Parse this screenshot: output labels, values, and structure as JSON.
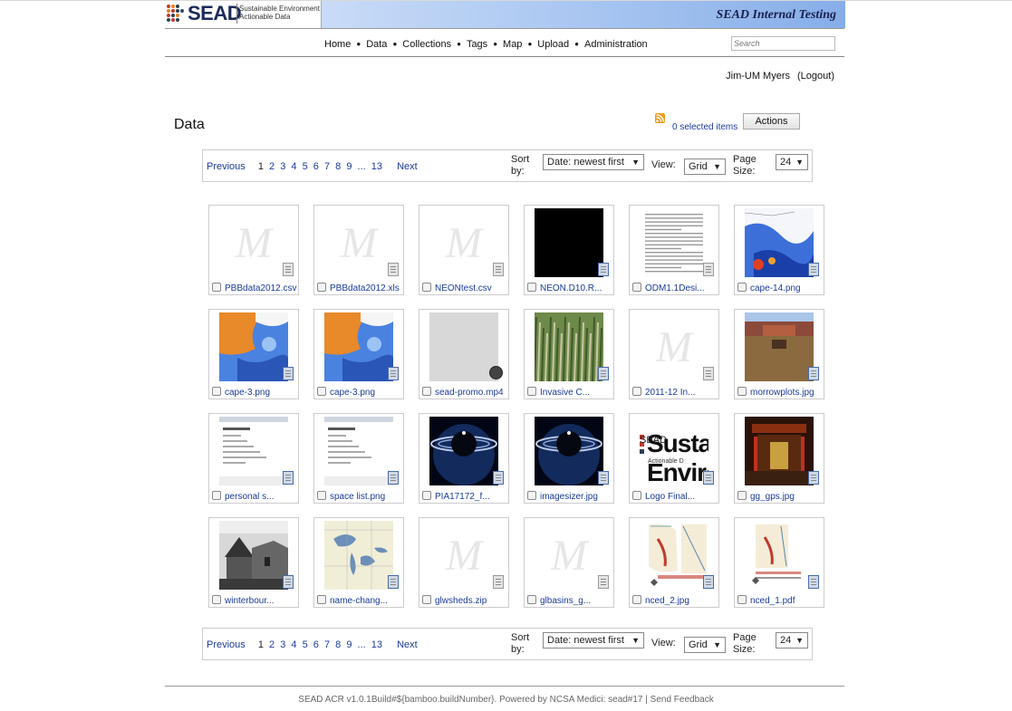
{
  "header": {
    "logo_text": "SEAD",
    "tagline_1": "Sustainable Environment",
    "tagline_2": "Actionable Data",
    "banner_title": "SEAD Internal Testing"
  },
  "nav": {
    "items": [
      "Home",
      "Data",
      "Collections",
      "Tags",
      "Map",
      "Upload",
      "Administration"
    ],
    "search_placeholder": "Search"
  },
  "user": {
    "name": "Jim-UM Myers",
    "logout": "(Logout)"
  },
  "page": {
    "title": "Data",
    "selected_items": "0 selected items",
    "actions_label": "Actions"
  },
  "pager": {
    "previous": "Previous",
    "pages": [
      "1",
      "2",
      "3",
      "4",
      "5",
      "6",
      "7",
      "8",
      "9"
    ],
    "ellipsis": "...",
    "last": "13",
    "next": "Next",
    "sort_label": "Sort by:",
    "sort_value": "Date: newest first",
    "view_label": "View:",
    "view_value": "Grid",
    "size_label": "Page Size:",
    "size_value": "24",
    "select_arrow": "▼"
  },
  "grid": {
    "items": [
      {
        "name": "PBBdata2012.csv",
        "thumb": "placeholder"
      },
      {
        "name": "PBBdata2012.xls",
        "thumb": "placeholder"
      },
      {
        "name": "NEONtest.csv",
        "thumb": "placeholder"
      },
      {
        "name": "NEON.D10.R...",
        "thumb": "black"
      },
      {
        "name": "ODM1.1Desi...",
        "thumb": "document"
      },
      {
        "name": "cape-14.png",
        "thumb": "map-blue"
      },
      {
        "name": "cape-3.png",
        "thumb": "map-orange"
      },
      {
        "name": "cape-3.png",
        "thumb": "map-orange"
      },
      {
        "name": "sead-promo.mp4",
        "thumb": "gray-video"
      },
      {
        "name": "Invasive C...",
        "thumb": "grass"
      },
      {
        "name": "2011-12 In...",
        "thumb": "placeholder"
      },
      {
        "name": "morrowplots.jpg",
        "thumb": "field"
      },
      {
        "name": "personal s...",
        "thumb": "screenshot"
      },
      {
        "name": "space list.png",
        "thumb": "screenshot"
      },
      {
        "name": "PIA17172_f...",
        "thumb": "saturn"
      },
      {
        "name": "imagesizer.jpg",
        "thumb": "saturn"
      },
      {
        "name": "Logo Final...",
        "thumb": "sead-logo"
      },
      {
        "name": "gg_gps.jpg",
        "thumb": "temple"
      },
      {
        "name": "winterbour...",
        "thumb": "church"
      },
      {
        "name": "name-chang...",
        "thumb": "greatlakes"
      },
      {
        "name": "glwsheds.zip",
        "thumb": "placeholder"
      },
      {
        "name": "glbasins_g...",
        "thumb": "placeholder"
      },
      {
        "name": "nced_2.jpg",
        "thumb": "ncmap"
      },
      {
        "name": "nced_1.pdf",
        "thumb": "ncmap-doc"
      }
    ],
    "placeholder_glyph": "M",
    "logo_thumb_text": "SEAD",
    "logo_thumb_tag1": "Sustainable Environm",
    "logo_thumb_tag2": "Actionable D"
  },
  "footer": {
    "text": "SEAD ACR v1.0.1Build#${bamboo.buildNumber}. Powered by NCSA Medici: sead#17 | ",
    "feedback": "Send Feedback"
  },
  "colors": {
    "link": "#1a3a9a",
    "banner_gradient_start": "#c9dbf7",
    "banner_gradient_end": "#86aee8",
    "rss": "#f39a1e"
  }
}
